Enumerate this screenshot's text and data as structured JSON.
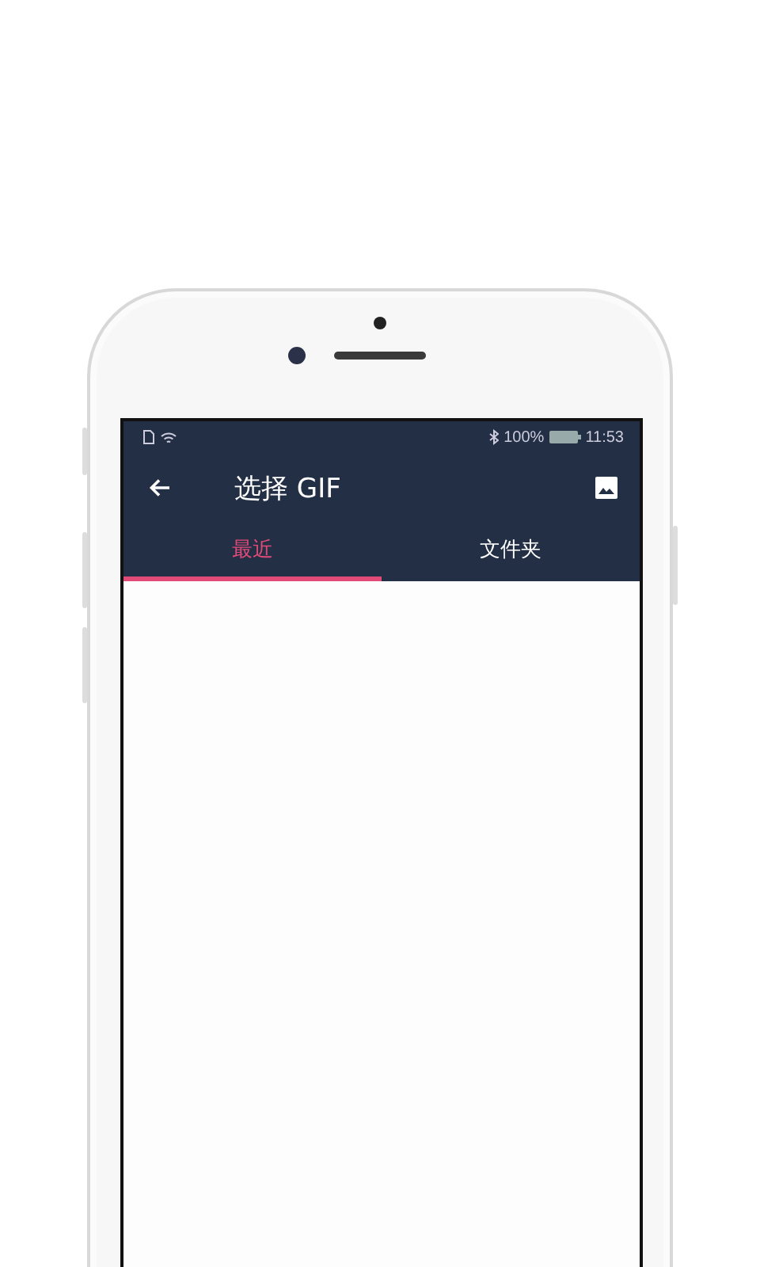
{
  "status_bar": {
    "battery": "100%",
    "time": "11:53"
  },
  "app_bar": {
    "title": "选择 GIF"
  },
  "tabs": [
    {
      "label": "最近",
      "selected": true
    },
    {
      "label": "文件夹",
      "selected": false
    }
  ]
}
